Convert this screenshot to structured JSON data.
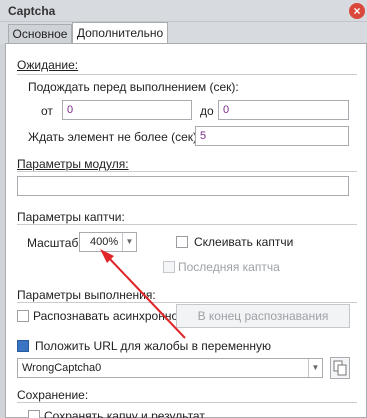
{
  "window": {
    "title": "Captcha"
  },
  "tabs": [
    {
      "label": "Основное"
    },
    {
      "label": "Дополнительно"
    }
  ],
  "waiting": {
    "section_label": "Ожидание:",
    "wait_before_label": "Подождать перед выполнением (сек):",
    "from_label": "от",
    "from_value": "0",
    "to_label": "до",
    "to_value": "0",
    "wait_element_label": "Ждать элемент не более (сек):",
    "wait_element_value": "5"
  },
  "module_params": {
    "section_label": "Параметры модуля:",
    "value": ""
  },
  "captcha_params": {
    "section_label": "Параметры каптчи:",
    "scale_label": "Масштаб",
    "scale_value": "400%",
    "glue_label": "Склеивать каптчи",
    "last_captcha_label": "Последняя каптча"
  },
  "exec_params": {
    "section_label": "Параметры выполнения:",
    "async_label": "Распознавать асинхронно",
    "end_recognition_button": "В конец распознавания"
  },
  "complaint": {
    "url_var_label": "Положить URL для жалобы в переменную",
    "var_value": "WrongCaptcha0"
  },
  "saving": {
    "section_label": "Сохранение:",
    "save_label": "Сохранять капчу и результат"
  },
  "colors": {
    "accent_arrow": "#e0262a",
    "field_value_text": "#7a2a8a",
    "checkbox_blue": "#3a74c4"
  }
}
